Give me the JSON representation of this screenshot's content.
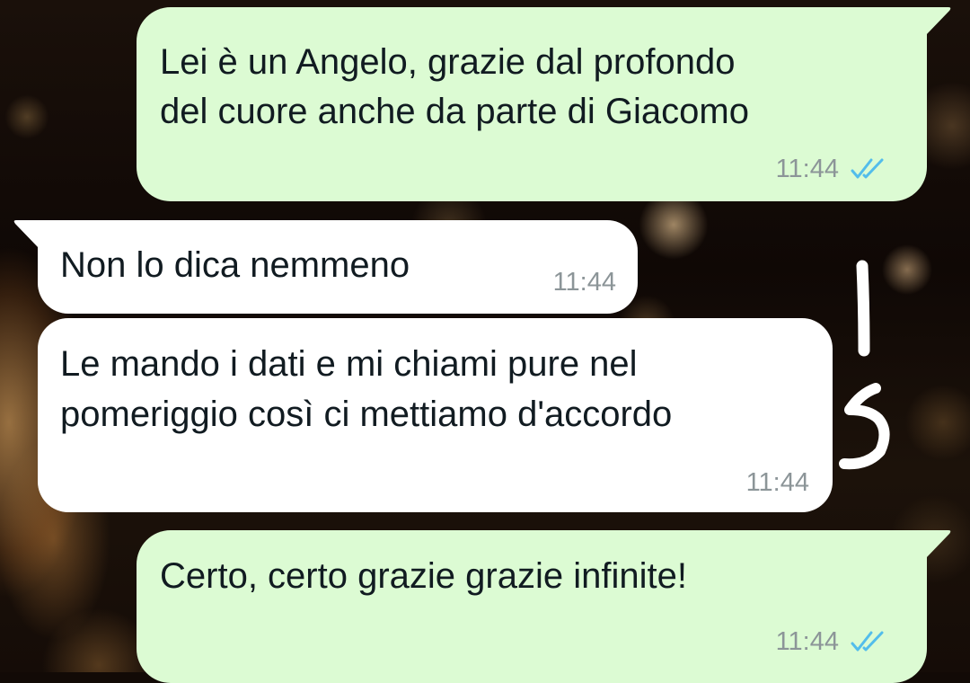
{
  "conversation": {
    "messages": [
      {
        "direction": "outgoing",
        "lines": [
          "Lei è un Angelo, grazie dal profondo",
          "del cuore anche da parte di Giacomo"
        ],
        "time": "11:44",
        "status": "read",
        "status_icon": "double-check-icon"
      },
      {
        "direction": "incoming",
        "lines": [
          "Non lo dica nemmeno"
        ],
        "time": "11:44"
      },
      {
        "direction": "incoming",
        "lines": [
          "Le mando i dati e mi chiami pure nel",
          "pomeriggio così ci mettiamo d'accordo"
        ],
        "time": "11:44"
      },
      {
        "direction": "outgoing",
        "lines": [
          "Certo, certo grazie grazie infinite!"
        ],
        "time": "11:44",
        "status": "read",
        "status_icon": "double-check-icon"
      }
    ]
  },
  "colors": {
    "outgoing_bubble": "#dcfbd3",
    "incoming_bubble": "#ffffff",
    "message_text": "#111b21",
    "timestamp": "#8c9598",
    "read_ticks": "#53bdeb",
    "scribble": "#ffffff"
  }
}
